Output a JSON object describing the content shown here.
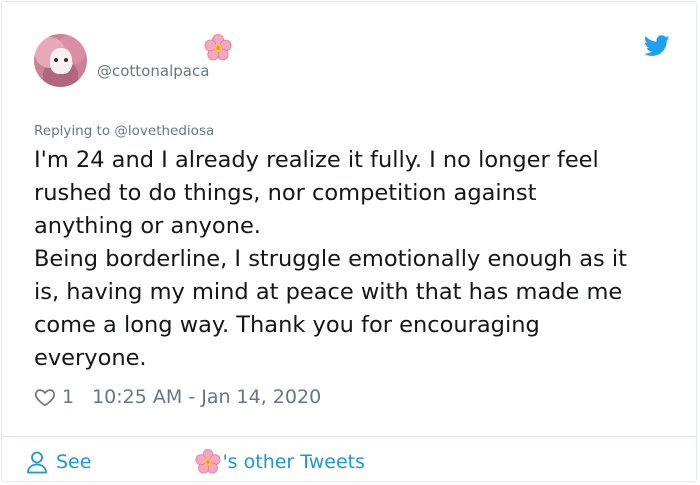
{
  "tweet": {
    "handle": "@cottonalpaca",
    "replying_to": "Replying to @lovethediosa",
    "text": "I'm 24 and I already realize it fully. I no longer feel\nrushed to do things, nor competition against\nanything or anyone.\nBeing borderline, I struggle emotionally enough as it\nis, having my mind at peace with that has made me\ncome a long way. Thank you for encouraging\neveryone.",
    "like_count": "1",
    "timestamp": "10:25 AM - Jan 14, 2020"
  },
  "footer": {
    "see_label": "See",
    "other_tweets_label": "'s other Tweets"
  },
  "icons": {
    "name_emoji": "cherry-blossom-icon",
    "brand": "twitter-bird-icon",
    "like": "heart-icon",
    "profile": "person-icon"
  },
  "colors": {
    "brand_blue": "#1da1f2",
    "link_blue": "#1b95e0",
    "muted": "#657786",
    "text": "#14171a",
    "border": "#e1e8ed"
  }
}
